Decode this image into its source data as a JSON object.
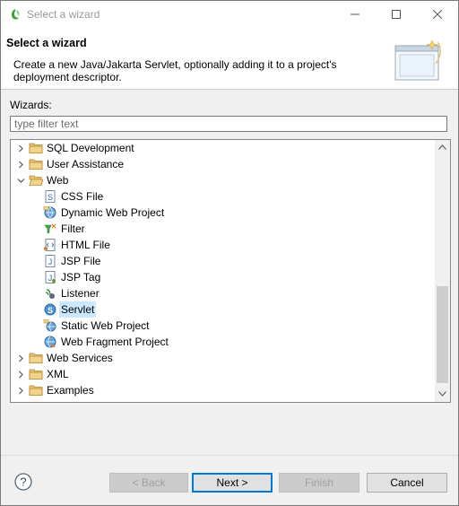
{
  "window": {
    "title": "Select a wizard"
  },
  "banner": {
    "title": "Select a wizard",
    "description": "Create a new Java/Jakarta Servlet, optionally adding it to a project's deployment descriptor."
  },
  "wizards_label": "Wizards:",
  "filter": {
    "placeholder": "type filter text",
    "value": ""
  },
  "tree": {
    "items": [
      {
        "label": "SQL Development",
        "icon": "folder-icon",
        "expanded": false,
        "level": 0
      },
      {
        "label": "User Assistance",
        "icon": "folder-icon",
        "expanded": false,
        "level": 0
      },
      {
        "label": "Web",
        "icon": "folder-open-icon",
        "expanded": true,
        "level": 0
      },
      {
        "label": "CSS File",
        "icon": "css-file-icon",
        "level": 1
      },
      {
        "label": "Dynamic Web Project",
        "icon": "dynamic-web-project-icon",
        "level": 1
      },
      {
        "label": "Filter",
        "icon": "filter-icon",
        "level": 1
      },
      {
        "label": "HTML File",
        "icon": "html-file-icon",
        "level": 1
      },
      {
        "label": "JSP File",
        "icon": "jsp-file-icon",
        "level": 1
      },
      {
        "label": "JSP Tag",
        "icon": "jsp-tag-icon",
        "level": 1
      },
      {
        "label": "Listener",
        "icon": "listener-icon",
        "level": 1
      },
      {
        "label": "Servlet",
        "icon": "servlet-icon",
        "level": 1,
        "selected": true
      },
      {
        "label": "Static Web Project",
        "icon": "static-web-project-icon",
        "level": 1
      },
      {
        "label": "Web Fragment Project",
        "icon": "web-fragment-project-icon",
        "level": 1
      },
      {
        "label": "Web Services",
        "icon": "folder-icon",
        "expanded": false,
        "level": 0
      },
      {
        "label": "XML",
        "icon": "folder-icon",
        "expanded": false,
        "level": 0
      },
      {
        "label": "Examples",
        "icon": "folder-icon",
        "expanded": false,
        "level": 0
      }
    ]
  },
  "buttons": {
    "back": "< Back",
    "next": "Next >",
    "finish": "Finish",
    "cancel": "Cancel"
  },
  "colors": {
    "selection": "#cce8ff",
    "default_button_border": "#0078d7",
    "folder": "#dcb35c"
  }
}
